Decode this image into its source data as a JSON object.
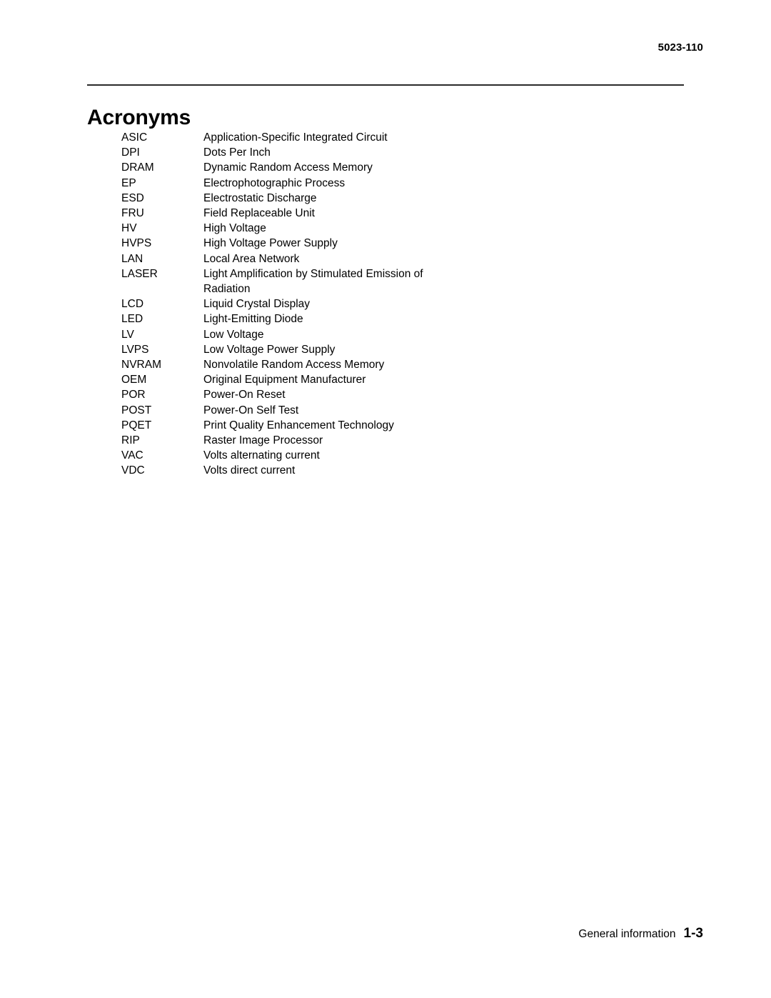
{
  "header": {
    "document_number": "5023-110"
  },
  "title": {
    "text": "Acronyms"
  },
  "acronyms": [
    {
      "term": "ASIC",
      "definition": "Application-Specific Integrated Circuit"
    },
    {
      "term": "DPI",
      "definition": "Dots Per Inch"
    },
    {
      "term": "DRAM",
      "definition": "Dynamic Random Access Memory"
    },
    {
      "term": "EP",
      "definition": "Electrophotographic Process"
    },
    {
      "term": "ESD",
      "definition": "Electrostatic Discharge"
    },
    {
      "term": "FRU",
      "definition": "Field Replaceable Unit"
    },
    {
      "term": "HV",
      "definition": "High Voltage"
    },
    {
      "term": "HVPS",
      "definition": "High Voltage Power Supply"
    },
    {
      "term": "LAN",
      "definition": "Local Area Network"
    },
    {
      "term": "LASER",
      "definition": "Light Amplification by Stimulated Emission of Radiation"
    },
    {
      "term": "LCD",
      "definition": "Liquid Crystal Display"
    },
    {
      "term": "LED",
      "definition": "Light-Emitting Diode"
    },
    {
      "term": "LV",
      "definition": "Low Voltage"
    },
    {
      "term": "LVPS",
      "definition": "Low Voltage Power Supply"
    },
    {
      "term": "NVRAM",
      "definition": "Nonvolatile Random Access Memory"
    },
    {
      "term": "OEM",
      "definition": "Original Equipment Manufacturer"
    },
    {
      "term": "POR",
      "definition": "Power-On Reset"
    },
    {
      "term": "POST",
      "definition": "Power-On Self Test"
    },
    {
      "term": "PQET",
      "definition": "Print Quality Enhancement Technology"
    },
    {
      "term": "RIP",
      "definition": "Raster Image Processor"
    },
    {
      "term": "VAC",
      "definition": "Volts alternating current"
    },
    {
      "term": "VDC",
      "definition": "Volts direct current"
    }
  ],
  "footer": {
    "section": "General information",
    "page_number": "1-3"
  }
}
